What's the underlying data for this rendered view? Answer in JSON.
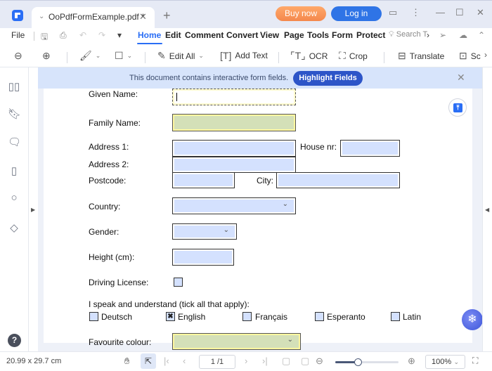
{
  "window": {
    "tab_title": "OoPdfFormExample.pdf *",
    "buy_label": "Buy now",
    "login_label": "Log in"
  },
  "menu": {
    "file": "File",
    "items": [
      "Home",
      "Edit",
      "Comment",
      "Convert",
      "View",
      "Page",
      "Tools",
      "Form",
      "Protect"
    ],
    "active": "Home",
    "search_placeholder": "Search T"
  },
  "toolbar": {
    "edit_all": "Edit All",
    "add_text": "Add Text",
    "ocr": "OCR",
    "crop": "Crop",
    "translate": "Translate",
    "screenshot": "Sc"
  },
  "banner": {
    "message": "This document contains interactive form fields.",
    "highlight_label": "Highlight Fields"
  },
  "form": {
    "given_name": {
      "label": "Given Name:",
      "value": ""
    },
    "family_name": {
      "label": "Family Name:",
      "value": ""
    },
    "address1": {
      "label": "Address 1:",
      "value": ""
    },
    "house_nr": {
      "label": "House nr:",
      "value": ""
    },
    "address2": {
      "label": "Address 2:",
      "value": ""
    },
    "postcode": {
      "label": "Postcode:",
      "value": ""
    },
    "city": {
      "label": "City:",
      "value": ""
    },
    "country": {
      "label": "Country:",
      "value": ""
    },
    "gender": {
      "label": "Gender:",
      "value": ""
    },
    "height": {
      "label": "Height (cm):",
      "value": ""
    },
    "driving_license": {
      "label": "Driving License:",
      "checked": false
    },
    "languages_label": "I speak and understand (tick all that apply):",
    "languages": [
      {
        "label": "Deutsch",
        "checked": false
      },
      {
        "label": "English",
        "checked": true,
        "mark": "✖"
      },
      {
        "label": "Français",
        "checked": false
      },
      {
        "label": "Esperanto",
        "checked": false
      },
      {
        "label": "Latin",
        "checked": false
      }
    ],
    "favourite_colour": {
      "label": "Favourite colour:",
      "value": ""
    }
  },
  "status": {
    "page_size": "20.99 x 29.7 cm",
    "page_indicator": "1 /1",
    "zoom": "100%",
    "zoom_fraction": 0.36
  },
  "help_label": "?"
}
